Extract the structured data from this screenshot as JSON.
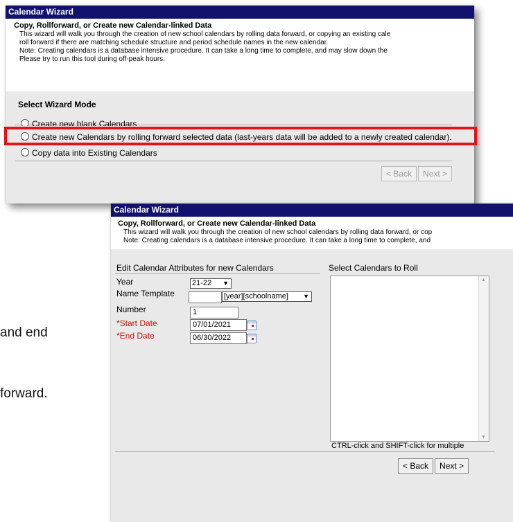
{
  "background_text": {
    "line1": "and end",
    "line2": "forward."
  },
  "window1": {
    "title": "Calendar Wizard",
    "header_title": "Copy, Rollforward, or Create new Calendar-linked Data",
    "description_lines": [
      "This wizard will walk you through the creation of new school calendars by rolling data forward, or copying an existing cale",
      "roll forward if there are matching schedule structure and period schedule names in the new calendar.",
      "Note: Creating calendars is a database intensive procedure. It can take a long time to complete, and may slow down the",
      "Please try to run this tool during off-peak hours."
    ],
    "mode_heading": "Select Wizard Mode",
    "options": [
      "Create new blank Calendars",
      "Create new Calendars by rolling forward selected data (last-years data will be added to a newly created calendar).",
      "Copy data into Existing Calendars"
    ],
    "highlight_color": "#e0141b",
    "back_label": "< Back",
    "next_label": "Next >"
  },
  "window2": {
    "title": "Calendar Wizard",
    "header_title": "Copy, Rollforward, or Create new Calendar-linked Data",
    "description_lines": [
      "This wizard will walk you through the creation of new school calendars by rolling data forward, or cop",
      "Note: Creating calendars is a database intensive procedure. It can take a long time to complete, and"
    ],
    "attributes_heading": "Edit Calendar Attributes for new Calendars",
    "select_heading": "Select Calendars to Roll",
    "year_label": "Year",
    "year_value": "21-22",
    "name_template_label": "Name Template",
    "name_template_value": "",
    "name_template_option": "[year][schoolname]",
    "number_label": "Number",
    "number_value": "1",
    "start_date_label": "*Start Date",
    "start_date_value": "07/01/2021",
    "end_date_label": "*End Date",
    "end_date_value": "06/30/2022",
    "hint": "CTRL-click and SHIFT-click for multiple",
    "back_label": "< Back",
    "next_label": "Next >"
  }
}
